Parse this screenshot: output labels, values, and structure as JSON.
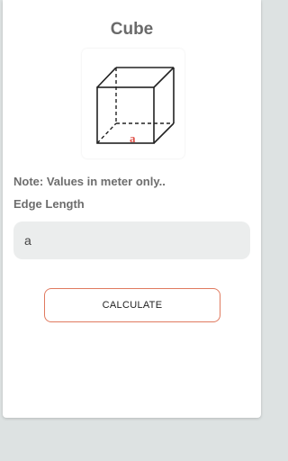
{
  "screen": {
    "title": "Cube",
    "figure": {
      "icon": "cube-diagram-icon",
      "edge_label": "a",
      "edge_label_color": "#e0524a"
    },
    "note": "Note: Values in meter only..",
    "edge_length": {
      "label": "Edge Length",
      "placeholder": "a",
      "value": ""
    },
    "calculate_label": "CALCULATE",
    "accent_color": "#e07a5f"
  }
}
